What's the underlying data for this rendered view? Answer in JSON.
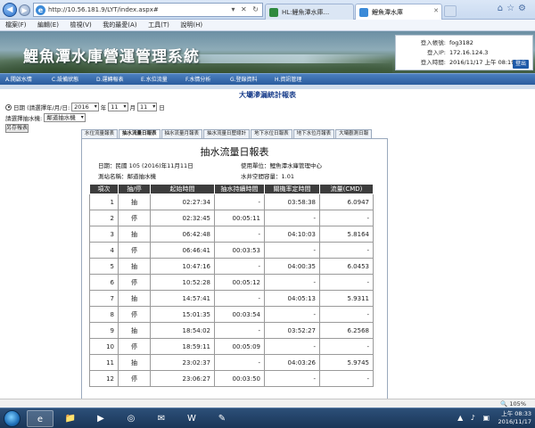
{
  "browser": {
    "address": "http://10.56.181.9/LYT/index.aspx#",
    "tabs": [
      {
        "label": "HL:鯉魚潭水庫...",
        "active": false
      },
      {
        "label": "鯉魚潭水庫",
        "active": true
      }
    ]
  },
  "menu": [
    "檔案(F)",
    "編輯(E)",
    "檢視(V)",
    "我的最愛(A)",
    "工具(T)",
    "說明(H)"
  ],
  "site": {
    "title": "鯉魚潭水庫營運管理系統",
    "login": {
      "account_label": "登入帳號:",
      "account": "fog3182",
      "ip_label": "登入IP:",
      "ip": "172.16.124.3",
      "time_label": "登入時間:",
      "time": "2016/11/17 上午 08:19:20",
      "logout": "登出"
    },
    "nav": [
      "A.開啟水情",
      "C.設備狀態",
      "D.運轉報表",
      "E.水位流量",
      "F.水情分析",
      "G.登錄資料",
      "H.資訊管理"
    ]
  },
  "page": {
    "heading": "大壩滲漏統計報表",
    "date_label": "日期 (請選擇年/月/日:",
    "year": "2016",
    "year_unit": "年",
    "month": "11",
    "month_unit": "月",
    "day": "11",
    "day_unit": "日",
    "pump_label": "請選擇抽水機:",
    "pump_value": "鄰道抽水機",
    "print_button": "另存報表",
    "report_tabs": [
      {
        "label": "水位流量報表",
        "active": false
      },
      {
        "label": "抽水流量日報表",
        "active": true
      },
      {
        "label": "抽水流量月報表",
        "active": false
      },
      {
        "label": "抽水流量日歷總計",
        "active": false
      },
      {
        "label": "地下水位日報表",
        "active": false
      },
      {
        "label": "地下水位月報表",
        "active": false
      },
      {
        "label": "大壩觀測日報",
        "active": false
      }
    ]
  },
  "report": {
    "title": "抽水流量日報表",
    "date_line": "日期：民國 105 (2016)年11月11日",
    "station_line": "測站名稱：鄰道抽水機",
    "unit_line": "使用單位：鯉魚潭水庫管理中心",
    "capacity_line": "水井空間容量：1.01",
    "columns": [
      "項次",
      "抽/停",
      "起始時間",
      "抽水持續時間",
      "關機率定時間",
      "流量(CMD)"
    ],
    "rows": [
      [
        "1",
        "抽",
        "02:27:34",
        "-",
        "03:58:38",
        "6.0947"
      ],
      [
        "2",
        "停",
        "02:32:45",
        "00:05:11",
        "-",
        "-"
      ],
      [
        "3",
        "抽",
        "06:42:48",
        "-",
        "04:10:03",
        "5.8164"
      ],
      [
        "4",
        "停",
        "06:46:41",
        "00:03:53",
        "-",
        "-"
      ],
      [
        "5",
        "抽",
        "10:47:16",
        "-",
        "04:00:35",
        "6.0453"
      ],
      [
        "6",
        "停",
        "10:52:28",
        "00:05:12",
        "-",
        "-"
      ],
      [
        "7",
        "抽",
        "14:57:41",
        "-",
        "04:05:13",
        "5.9311"
      ],
      [
        "8",
        "停",
        "15:01:35",
        "00:03:54",
        "-",
        "-"
      ],
      [
        "9",
        "抽",
        "18:54:02",
        "-",
        "03:52:27",
        "6.2568"
      ],
      [
        "10",
        "停",
        "18:59:11",
        "00:05:09",
        "-",
        "-"
      ],
      [
        "11",
        "抽",
        "23:02:37",
        "-",
        "04:03:26",
        "5.9745"
      ],
      [
        "12",
        "停",
        "23:06:27",
        "00:03:50",
        "-",
        "-"
      ]
    ]
  },
  "status": {
    "zoom": "105%"
  },
  "taskbar": {
    "time": "上午 08:33",
    "date": "2016/11/17"
  }
}
